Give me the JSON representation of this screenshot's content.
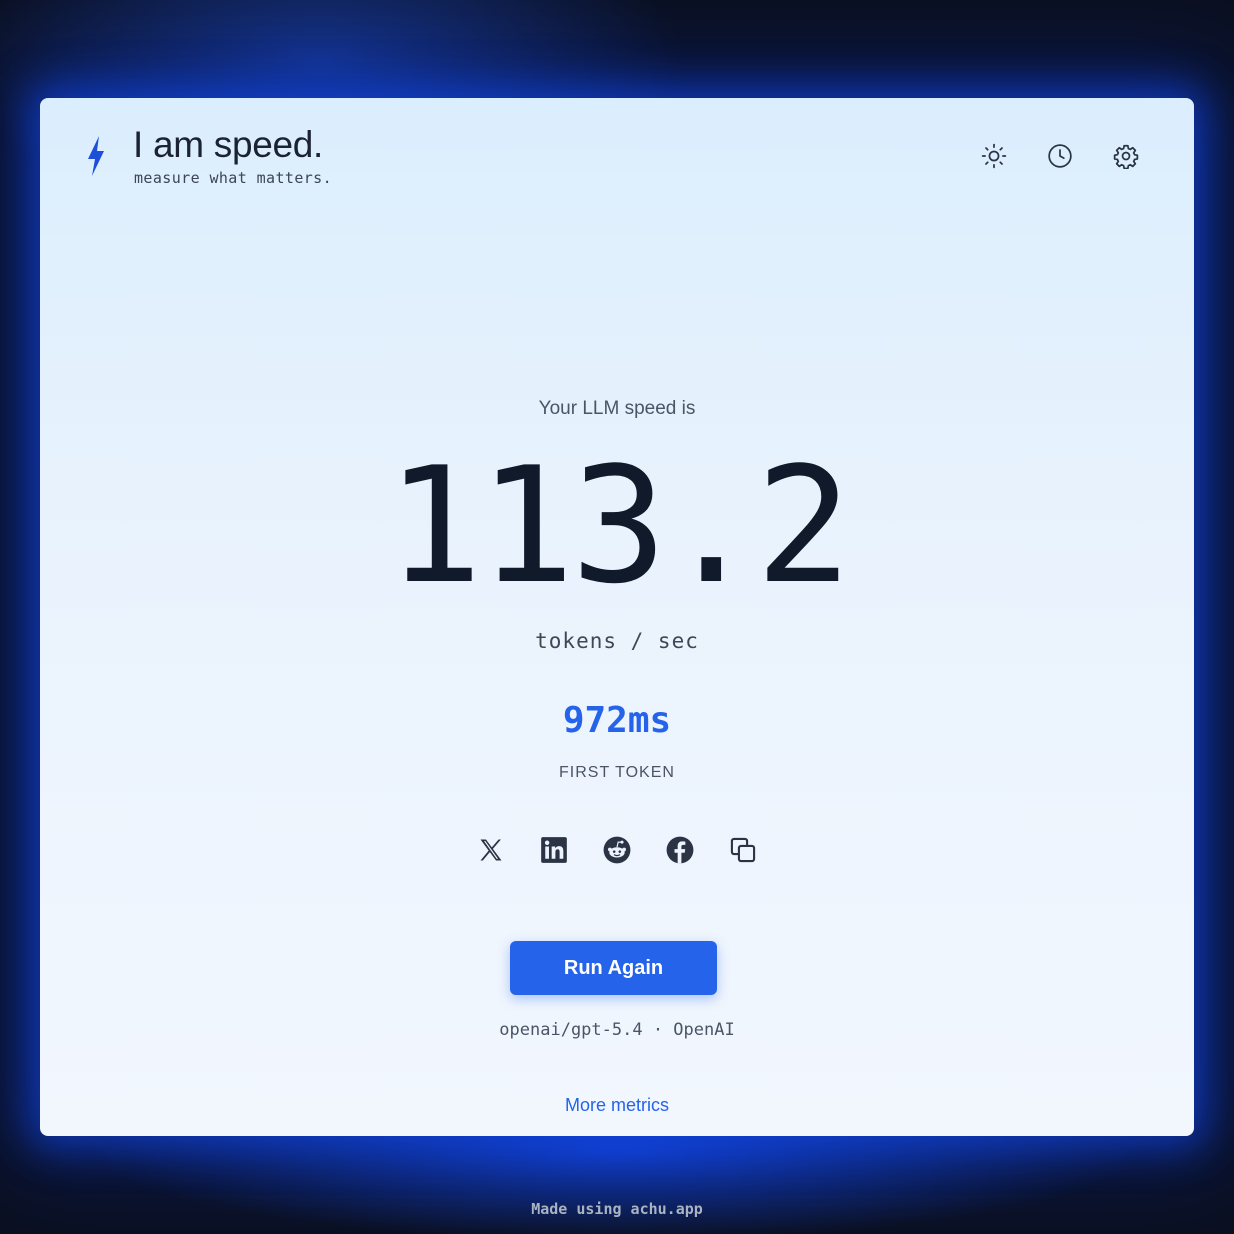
{
  "header": {
    "title": "I am speed.",
    "subtitle": "measure what matters.",
    "logo_icon": "lightning-bolt-icon",
    "actions": [
      {
        "name": "theme-toggle-button",
        "icon": "sun-icon"
      },
      {
        "name": "history-button",
        "icon": "clock-icon"
      },
      {
        "name": "settings-button",
        "icon": "gear-icon"
      }
    ]
  },
  "result": {
    "lead": "Your LLM speed is",
    "value": "113.2",
    "unit": "tokens / sec",
    "first_token_value": "972ms",
    "first_token_label": "FIRST TOKEN"
  },
  "share": {
    "icons": [
      "x-icon",
      "linkedin-icon",
      "reddit-icon",
      "facebook-icon",
      "copy-icon"
    ]
  },
  "actions": {
    "run_again_label": "Run Again"
  },
  "model": {
    "line": "openai/gpt-5.4 · OpenAI"
  },
  "links": {
    "more_metrics": "More metrics"
  },
  "footer": {
    "text": "Made using achu.app"
  },
  "colors": {
    "accent": "#2563eb",
    "text_dark": "#111a2b",
    "page_bg": "#0b1020",
    "card_top": "#dbeefd",
    "card_bottom": "#f2f7fe"
  }
}
